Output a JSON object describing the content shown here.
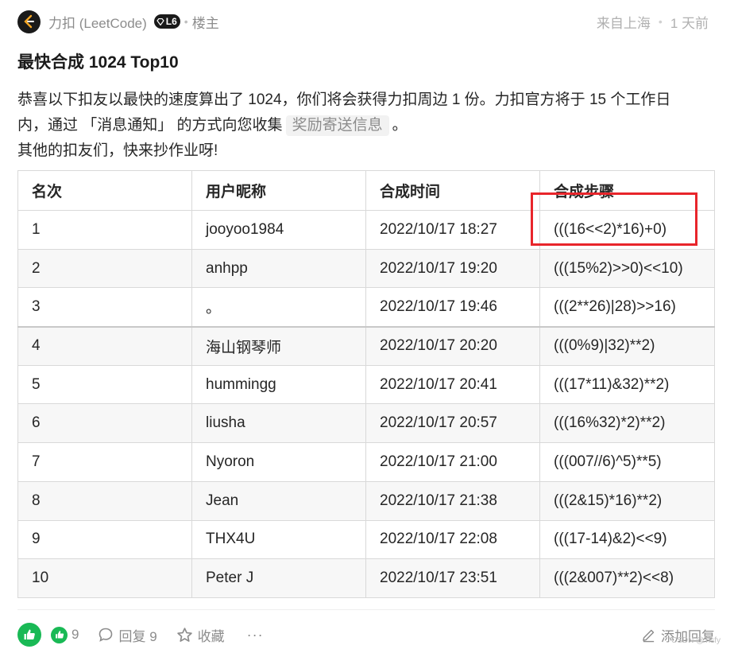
{
  "post": {
    "author": "力扣 (LeetCode)",
    "level": "L6",
    "role": "楼主",
    "location": "来自上海",
    "time": "1 天前",
    "title": "最快合成 1024 Top10",
    "para_line1": "恭喜以下扣友以最快的速度算出了 1024，你们将会获得力扣周边 1 份。力扣官方将于 15 个工作日",
    "para_line2_pre": "内，通过 「消息通知」 的方式向您收集",
    "para_tag": "奖励寄送信息",
    "para_line2_post": "。",
    "para_line3": "其他的扣友们，快来抄作业呀!"
  },
  "table": {
    "headers": [
      "名次",
      "用户昵称",
      "合成时间",
      "合成步骤"
    ],
    "rows": [
      [
        "1",
        "jooyoo1984",
        "2022/10/17 18:27",
        "(((16<<2)*16)+0)"
      ],
      [
        "2",
        "anhpp",
        "2022/10/17 19:20",
        "(((15%2)>>0)<<10)"
      ],
      [
        "3",
        "。",
        "2022/10/17 19:46",
        "(((2**26)|28)>>16)"
      ],
      [
        "4",
        "海山钢琴师",
        "2022/10/17 20:20",
        "(((0%9)|32)**2)"
      ],
      [
        "5",
        "hummingg",
        "2022/10/17 20:41",
        "(((17*11)&32)**2)"
      ],
      [
        "6",
        "liusha",
        "2022/10/17 20:57",
        "(((16%32)*2)**2)"
      ],
      [
        "7",
        "Nyoron",
        "2022/10/17 21:00",
        "(((007//6)^5)**5)"
      ],
      [
        "8",
        "Jean",
        "2022/10/17 21:38",
        "(((2&15)*16)**2)"
      ],
      [
        "9",
        "THX4U",
        "2022/10/17 22:08",
        "(((17-14)&2)<<9)"
      ],
      [
        "10",
        "Peter J",
        "2022/10/17 23:51",
        "(((2&007)**2)<<8)"
      ]
    ]
  },
  "footer": {
    "like_count": "9",
    "reply_label": "回复 9",
    "collect_label": "收藏",
    "more_label": "···",
    "add_reply_label": "添加回复",
    "watermark": "CSDN @Tisfy"
  },
  "colors": {
    "accent_green": "#19b955",
    "highlight_red": "#e8252b"
  }
}
